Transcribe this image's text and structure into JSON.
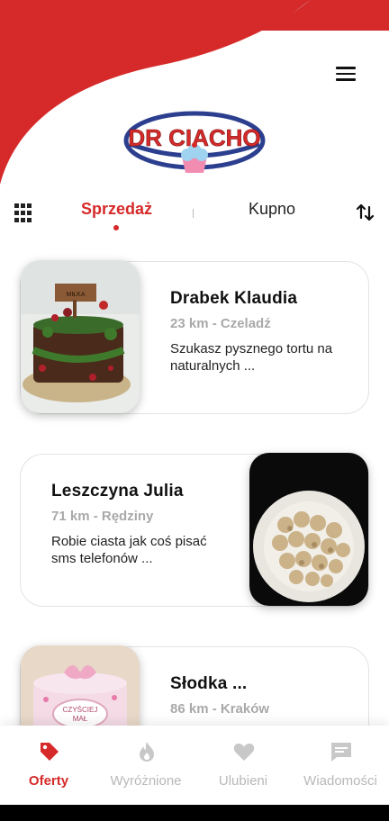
{
  "app": {
    "logo_text": "DR CIACHO",
    "colors": {
      "brand_red": "#d62a2a",
      "logo_blue": "#2c3f8f",
      "muted": "#a9a9a9"
    }
  },
  "header": {
    "menu_icon": "hamburger-menu-icon"
  },
  "tabs": {
    "grid_icon": "grid-view-icon",
    "sell_label": "Sprzedaż",
    "buy_label": "Kupno",
    "sort_icon": "sort-arrows-icon",
    "active": "sell"
  },
  "offers": [
    {
      "name": "Drabek Klaudia",
      "distance": "23 km - Czeladź",
      "description": "Szukasz pysznego tortu na naturalnych ...",
      "image": "forest-cake-photo"
    },
    {
      "name": "Leszczyna Julia",
      "distance": "71 km - Rędziny",
      "description": "Robie ciasta jak coś pisać sms telefonów ...",
      "image": "cookies-plate-photo"
    },
    {
      "name": "Słodka ...",
      "distance": "86 km - Kraków",
      "description": "",
      "image": "pink-cake-photo"
    }
  ],
  "bottom_nav": {
    "items": [
      {
        "label": "Oferty",
        "icon": "tag-icon",
        "active": true
      },
      {
        "label": "Wyróżnione",
        "icon": "flame-icon",
        "active": false
      },
      {
        "label": "Ulubieni",
        "icon": "heart-icon",
        "active": false
      },
      {
        "label": "Wiadomości",
        "icon": "chat-icon",
        "active": false
      }
    ]
  }
}
